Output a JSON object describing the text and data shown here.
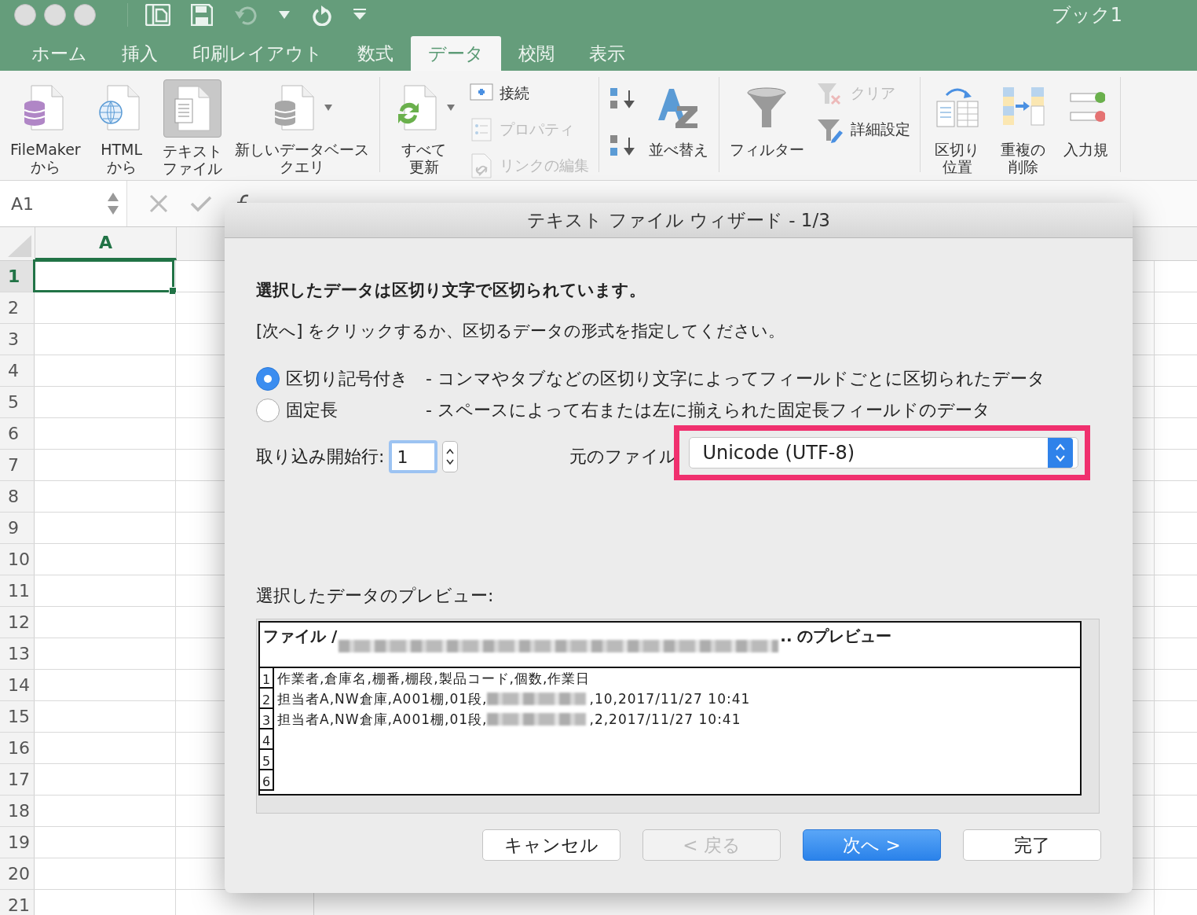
{
  "window": {
    "title": "ブック1"
  },
  "ribbon_tabs": [
    {
      "label": "ホーム",
      "selected": false
    },
    {
      "label": "挿入",
      "selected": false
    },
    {
      "label": "印刷レイアウト",
      "selected": false
    },
    {
      "label": "数式",
      "selected": false
    },
    {
      "label": "データ",
      "selected": true
    },
    {
      "label": "校閲",
      "selected": false
    },
    {
      "label": "表示",
      "selected": false
    }
  ],
  "ribbon_groups": [
    {
      "items": [
        {
          "kind": "large",
          "label": [
            "FileMaker",
            "から"
          ],
          "selected": false
        },
        {
          "kind": "large",
          "label": [
            "HTML",
            "から"
          ],
          "selected": false
        },
        {
          "kind": "large",
          "label": [
            "テキスト",
            "ファイル"
          ],
          "selected": true
        },
        {
          "kind": "large",
          "label": [
            "新しいデータベース",
            "クエリ"
          ],
          "selected": false
        }
      ]
    },
    {
      "items": [
        {
          "kind": "large",
          "label": [
            "すべて",
            "更新"
          ],
          "selected": false
        },
        {
          "kind": "small",
          "label": "接続",
          "disabled": false
        },
        {
          "kind": "small",
          "label": "プロパティ",
          "disabled": true
        },
        {
          "kind": "small",
          "label": "リンクの編集",
          "disabled": true
        }
      ]
    },
    {
      "items": [
        {
          "kind": "icon"
        },
        {
          "kind": "icon"
        },
        {
          "kind": "large",
          "label": [
            "並べ替え"
          ],
          "selected": false
        }
      ]
    },
    {
      "items": [
        {
          "kind": "large",
          "label": [
            "フィルター"
          ],
          "selected": false
        },
        {
          "kind": "small",
          "label": "クリア",
          "disabled": true
        },
        {
          "kind": "small",
          "label": "詳細設定",
          "disabled": false
        }
      ]
    },
    {
      "items": [
        {
          "kind": "large",
          "label": [
            "区切り",
            "位置"
          ],
          "selected": false
        },
        {
          "kind": "large",
          "label": [
            "重複の",
            "削除"
          ],
          "selected": false
        },
        {
          "kind": "large",
          "label": [
            "入力規"
          ],
          "selected": false
        }
      ]
    }
  ],
  "name_box": "A1",
  "sheet": {
    "column_header": "A",
    "rows": [
      {
        "label": "1",
        "selected": true
      },
      {
        "label": "2",
        "selected": false
      },
      {
        "label": "3",
        "selected": false
      },
      {
        "label": "4",
        "selected": false
      },
      {
        "label": "5",
        "selected": false
      },
      {
        "label": "6",
        "selected": false
      },
      {
        "label": "7",
        "selected": false
      },
      {
        "label": "8",
        "selected": false
      },
      {
        "label": "9",
        "selected": false
      },
      {
        "label": "10",
        "selected": false
      },
      {
        "label": "11",
        "selected": false
      },
      {
        "label": "12",
        "selected": false
      },
      {
        "label": "13",
        "selected": false
      },
      {
        "label": "14",
        "selected": false
      },
      {
        "label": "15",
        "selected": false
      },
      {
        "label": "16",
        "selected": false
      },
      {
        "label": "17",
        "selected": false
      },
      {
        "label": "18",
        "selected": false
      },
      {
        "label": "19",
        "selected": false
      },
      {
        "label": "20",
        "selected": false
      },
      {
        "label": "21",
        "selected": false
      }
    ]
  },
  "dialog": {
    "title": "テキスト ファイル ウィザード - 1/3",
    "heading": "選択したデータは区切り文字で区切られています。",
    "instruction": "[次へ] をクリックするか、区切るデータの形式を指定してください。",
    "options": [
      {
        "label": "区切り記号付き",
        "description": "- コンマやタブなどの区切り文字によってフィールドごとに区切られたデータ",
        "selected": true
      },
      {
        "label": "固定長",
        "description": "- スペースによって右または左に揃えられた固定長フィールドのデータ",
        "selected": false
      }
    ],
    "start_row": {
      "label": "取り込み開始行:",
      "value": "1"
    },
    "file_origin": {
      "label": "元のファイル",
      "value": "Unicode (UTF-8)",
      "highlighted": true
    },
    "preview": {
      "label": "選択したデータのプレビュー:",
      "header_prefix": "ファイル /",
      "header_suffix": ".. のプレビュー",
      "rows": [
        {
          "number": "1",
          "segments": [
            {
              "kind": "text",
              "text": "作業者,倉庫名,棚番,棚段,製品コード,個数,作業日"
            }
          ]
        },
        {
          "number": "2",
          "segments": [
            {
              "kind": "text",
              "text": "担当者A,NW倉庫,A001棚,01段,"
            },
            {
              "kind": "redacted"
            },
            {
              "kind": "text",
              "text": ",10,2017/11/27 10:41"
            }
          ]
        },
        {
          "number": "3",
          "segments": [
            {
              "kind": "text",
              "text": "担当者A,NW倉庫,A001棚,01段,"
            },
            {
              "kind": "redacted"
            },
            {
              "kind": "text",
              "text": ",2,2017/11/27 10:41"
            }
          ]
        },
        {
          "number": "4"
        },
        {
          "number": "5"
        },
        {
          "number": "6"
        }
      ]
    },
    "buttons": [
      {
        "label": "キャンセル",
        "kind": "normal"
      },
      {
        "label": "< 戻る",
        "kind": "disabled"
      },
      {
        "label": "次へ >",
        "kind": "primary"
      },
      {
        "label": "完了",
        "kind": "normal"
      }
    ]
  }
}
